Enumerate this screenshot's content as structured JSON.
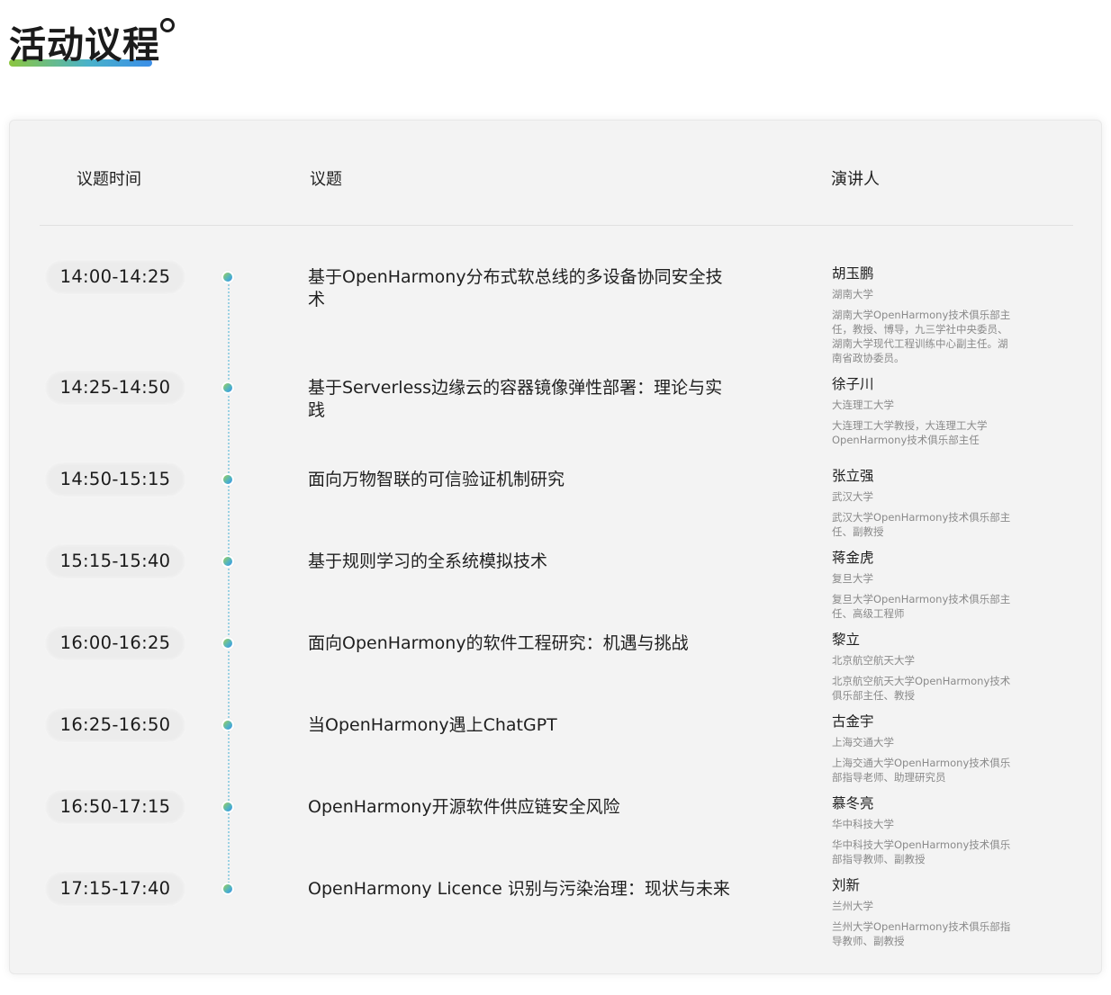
{
  "page": {
    "title": "活动议程"
  },
  "table": {
    "headers": {
      "time": "议题时间",
      "topic": "议题",
      "speaker": "演讲人"
    },
    "rows": [
      {
        "time": "14:00-14:25",
        "topic": "基于OpenHarmony分布式软总线的多设备协同安全技术",
        "speaker": "胡玉鹏",
        "org": "湖南大学",
        "desc": "湖南大学OpenHarmony技术俱乐部主任，教授、博导，九三学社中央委员、湖南大学现代工程训练中心副主任。湖南省政协委员。"
      },
      {
        "time": "14:25-14:50",
        "topic": "基于Serverless边缘云的容器镜像弹性部署：理论与实践",
        "speaker": "徐子川",
        "org": "大连理工大学",
        "desc": "大连理工大学教授，大连理工大学OpenHarmony技术俱乐部主任"
      },
      {
        "time": "14:50-15:15",
        "topic": "面向万物智联的可信验证机制研究",
        "speaker": "张立强",
        "org": "武汉大学",
        "desc": "武汉大学OpenHarmony技术俱乐部主任、副教授"
      },
      {
        "time": "15:15-15:40",
        "topic": "基于规则学习的全系统模拟技术",
        "speaker": "蒋金虎",
        "org": "复旦大学",
        "desc": "复旦大学OpenHarmony技术俱乐部主任、高级工程师"
      },
      {
        "time": "16:00-16:25",
        "topic": "面向OpenHarmony的软件工程研究：机遇与挑战",
        "speaker": "黎立",
        "org": "北京航空航天大学",
        "desc": "北京航空航天大学OpenHarmony技术俱乐部主任、教授"
      },
      {
        "time": "16:25-16:50",
        "topic": "当OpenHarmony遇上ChatGPT",
        "speaker": "古金宇",
        "org": "上海交通大学",
        "desc": "上海交通大学OpenHarmony技术俱乐部指导老师、助理研究员"
      },
      {
        "time": "16:50-17:15",
        "topic": "OpenHarmony开源软件供应链安全风险",
        "speaker": "慕冬亮",
        "org": "华中科技大学",
        "desc": "华中科技大学OpenHarmony技术俱乐部指导教师、副教授"
      },
      {
        "time": "17:15-17:40",
        "topic": "OpenHarmony Licence 识别与污染治理：现状与未来",
        "speaker": "刘新",
        "org": "兰州大学",
        "desc": "兰州大学OpenHarmony技术俱乐部指导教师、副教授"
      }
    ]
  }
}
